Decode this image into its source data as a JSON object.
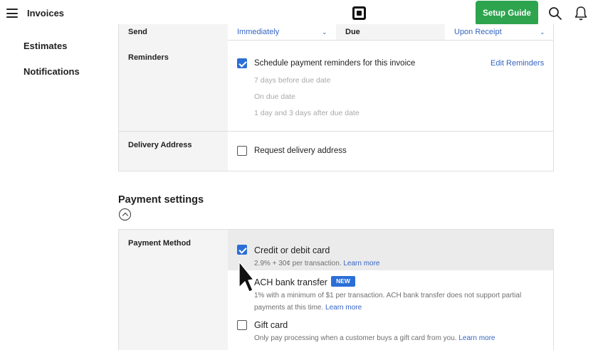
{
  "header": {
    "nav_title": "Invoices",
    "setup_button": "Setup Guide",
    "accent_color": "#2ea44f"
  },
  "sidebar": {
    "items": [
      {
        "label": "Estimates"
      },
      {
        "label": "Notifications"
      }
    ]
  },
  "settings": {
    "send": {
      "label": "Send",
      "value": "Immediately",
      "due_label": "Due",
      "due_value": "Upon Receipt"
    },
    "reminders": {
      "label": "Reminders",
      "checkbox_label": "Schedule payment reminders for this invoice",
      "checked": true,
      "edit_link": "Edit Reminders",
      "schedule": [
        "7 days before due date",
        "On due date",
        "1 day and 3 days after due date"
      ]
    },
    "delivery": {
      "label": "Delivery Address",
      "checkbox_label": "Request delivery address",
      "checked": false
    }
  },
  "payment": {
    "section_title": "Payment settings",
    "method_label": "Payment Method",
    "options": [
      {
        "label": "Credit or debit card",
        "checked": true,
        "description": "2.9% + 30¢ per transaction.",
        "link": "Learn more"
      },
      {
        "label": "ACH bank transfer",
        "badge": "NEW",
        "description_line1": "1% with a minimum of $1 per transaction. ACH bank transfer does not support partial",
        "description_line2": "payments at this time.",
        "link": "Learn more"
      },
      {
        "label": "Gift card",
        "checked": false,
        "description": "Only pay processing when a customer buys a gift card from you.",
        "link": "Learn more"
      }
    ]
  }
}
